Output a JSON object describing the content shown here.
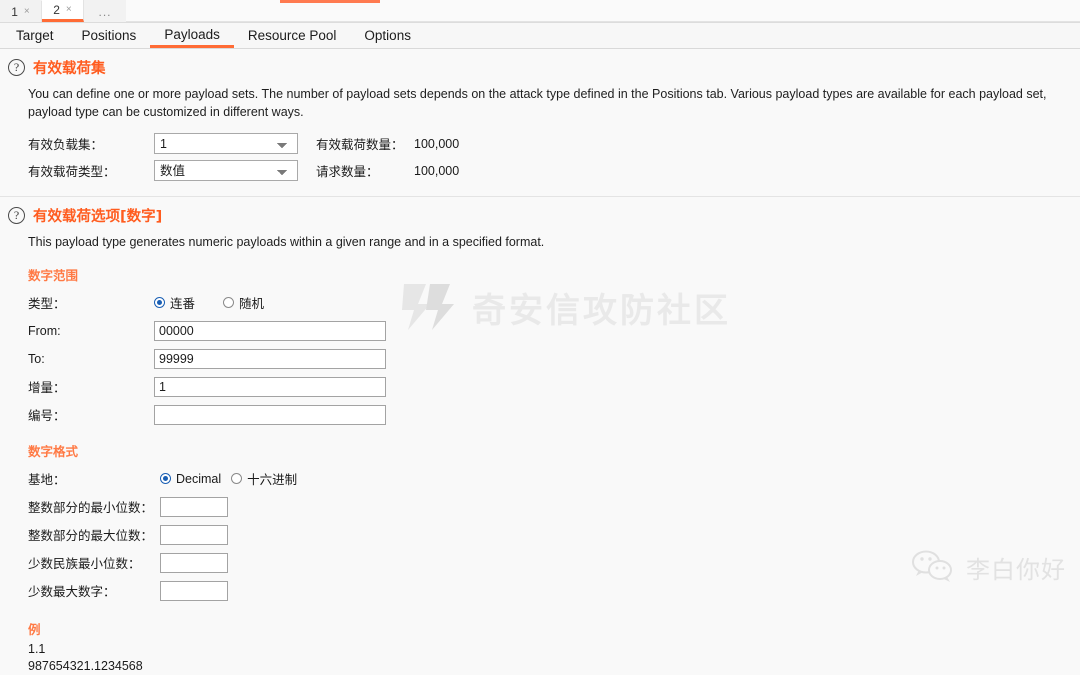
{
  "window_tabs": {
    "items": [
      {
        "label": "1",
        "close": "×",
        "active": false
      },
      {
        "label": "2",
        "close": "×",
        "active": true
      },
      {
        "label": "...",
        "close": "",
        "active": false
      }
    ],
    "accent_color": "#ff7a50"
  },
  "nav_tabs": {
    "items": [
      {
        "label": "Target",
        "active": false
      },
      {
        "label": "Positions",
        "active": false
      },
      {
        "label": "Payloads",
        "active": true
      },
      {
        "label": "Resource Pool",
        "active": false
      },
      {
        "label": "Options",
        "active": false
      }
    ],
    "active_underline_color": "#ff6b35"
  },
  "payload_sets": {
    "help_icon": "question-mark-icon",
    "title": "有效载荷集",
    "description": "You can define one or more payload sets. The number of payload sets depends on the attack type defined in the Positions tab. Various payload types are available for each payload set,\npayload type can be customized in different ways.",
    "payload_set_label": "有效负载集：",
    "payload_set_value": "1",
    "payload_set_options": [
      "1"
    ],
    "payload_type_label": "有效载荷类型：",
    "payload_type_value": "数值",
    "payload_type_options": [
      "数值"
    ],
    "payload_count_label": "有效载荷数量：",
    "payload_count_value": "100,000",
    "request_count_label": "请求数量：",
    "request_count_value": "100,000"
  },
  "payload_options": {
    "help_icon": "question-mark-icon",
    "title": "有效载荷选项[数字]",
    "description": "This payload type generates numeric payloads within a given range and in a specified format.",
    "number_range": {
      "subtitle": "数字范围",
      "type_label": "类型：",
      "type_options": [
        {
          "label": "连番",
          "checked": true
        },
        {
          "label": "随机",
          "checked": false
        }
      ],
      "from_label": "From:",
      "from_value": "00000",
      "to_label": "To:",
      "to_value": "99999",
      "step_label": "增量：",
      "step_value": "1",
      "number_label": "编号：",
      "number_value": ""
    },
    "number_format": {
      "subtitle": "数字格式",
      "base_label": "基地：",
      "base_options": [
        {
          "label": "Decimal",
          "checked": true
        },
        {
          "label": "十六进制",
          "checked": false
        }
      ],
      "min_int_digits_label": "整数部分的最小位数：",
      "min_int_digits_value": "",
      "max_int_digits_label": "整数部分的最大位数：",
      "max_int_digits_value": "",
      "min_frac_digits_label": "少数民族最小位数：",
      "min_frac_digits_value": "",
      "max_frac_digits_label": "少数最大数字：",
      "max_frac_digits_value": ""
    },
    "example": {
      "title": "例",
      "lines": [
        "1.1",
        "987654321.1234568"
      ]
    }
  },
  "watermarks": {
    "center_icon": "qianxin-logo-icon",
    "center_text": "奇安信攻防社区",
    "badge_icon": "wechat-icon",
    "badge_text": "李白你好"
  }
}
